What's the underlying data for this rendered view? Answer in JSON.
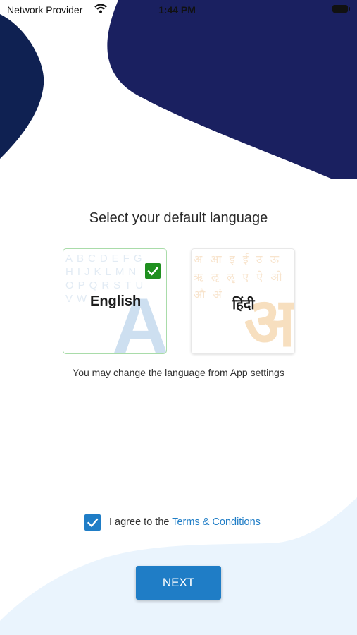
{
  "status_bar": {
    "carrier": "Network Provider",
    "time": "1:44 PM",
    "icons": [
      "wifi-icon",
      "battery-icon"
    ]
  },
  "colors": {
    "navy": "#1a2060",
    "accent_blue": "#1f7dc6",
    "check_green": "#1f8f1f",
    "bottom_wave": "#eaf4fd"
  },
  "main": {
    "title": "Select your default language",
    "hint": "You may change the language from App settings",
    "languages": [
      {
        "label": "English",
        "selected": true,
        "background_letters": "ABCDEFG\nHIJKLMN\nOPQRSTU\nVW",
        "big_glyph": "A"
      },
      {
        "label": "हिंदी",
        "selected": false,
        "background_letters": "अ आ इ ई उ ऊ\nऋ ऌ ॡ ए ऐ ओ\nऔ अं",
        "big_glyph": "अ"
      }
    ]
  },
  "agreement": {
    "checked": true,
    "text": "I agree to the ",
    "link": "Terms & Conditions"
  },
  "next_label": "NEXT"
}
